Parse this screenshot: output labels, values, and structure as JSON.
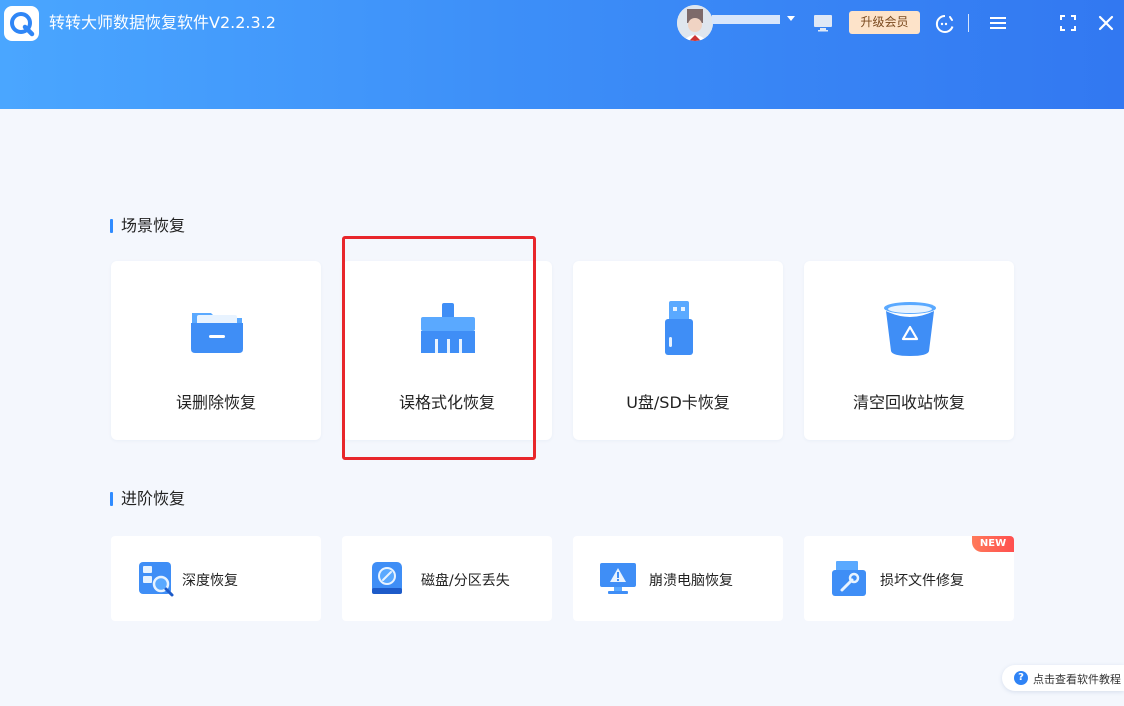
{
  "header": {
    "app_title": "转转大师数据恢复软件V2.2.3.2",
    "upgrade_label": "升级会员"
  },
  "scene_recovery": {
    "title": "场景恢复",
    "cards": [
      {
        "label": "误删除恢复",
        "icon": "folder-icon"
      },
      {
        "label": "误格式化恢复",
        "icon": "broom-icon"
      },
      {
        "label": "U盘/SD卡恢复",
        "icon": "usb-drive-icon"
      },
      {
        "label": "清空回收站恢复",
        "icon": "recycle-bin-icon"
      }
    ]
  },
  "advanced_recovery": {
    "title": "进阶恢复",
    "cards": [
      {
        "label": "深度恢复",
        "icon": "deep-scan-icon"
      },
      {
        "label": "磁盘/分区丢失",
        "icon": "disk-partition-icon"
      },
      {
        "label": "崩溃电脑恢复",
        "icon": "crashed-computer-icon"
      },
      {
        "label": "损坏文件修复",
        "icon": "file-repair-icon",
        "badge": "NEW"
      }
    ]
  },
  "help": {
    "label": "点击查看软件教程",
    "icon": "question-icon"
  },
  "colors": {
    "header_start": "#4aa6ff",
    "header_end": "#3278f1",
    "accent": "#2f8bff",
    "highlight": "#e8262b",
    "upgrade_bg": "#fde3c9"
  }
}
